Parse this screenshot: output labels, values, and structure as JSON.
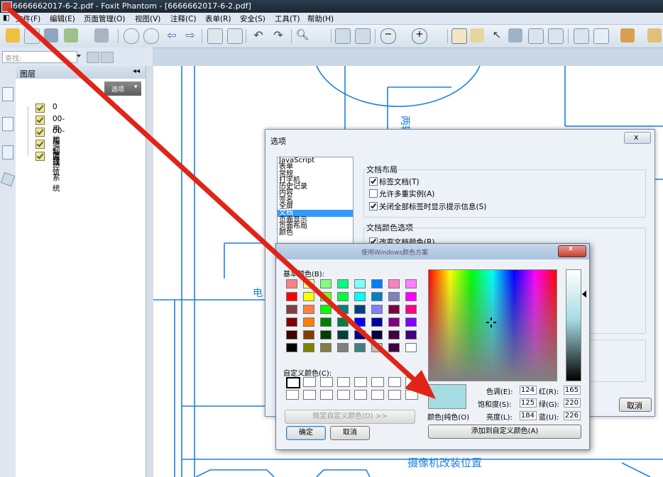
{
  "window": {
    "title": "6666662017-6-2.pdf - Foxit Phantom - [6666662017-6-2.pdf]"
  },
  "menu": [
    "文件(F)",
    "编辑(E)",
    "页面管理(O)",
    "视图(V)",
    "注释(C)",
    "表单(R)",
    "安全(S)",
    "工具(T)",
    "帮助(H)"
  ],
  "search": {
    "placeholder": "查找:"
  },
  "layers_panel": {
    "title": "图层",
    "options_label": "选项",
    "items": [
      "0",
      "00-用地红线",
      "00-规划建筑",
      "墙面",
      "监控系统"
    ]
  },
  "drawing": {
    "text_top": "两轮",
    "text_left": "电",
    "text_bottom": "摄像机改装位置"
  },
  "options_dialog": {
    "title": "选项",
    "close": "x",
    "categories": [
      "JavaScript",
      "表单",
      "常规",
      "打字机",
      "历史记录",
      "内容",
      "签名",
      "全屏",
      "文档",
      "页面显示",
      "页面布局",
      "颜色"
    ],
    "selected_category": "文档",
    "layout_group": "文档布局",
    "layout_options": [
      {
        "label": "标签文档(T)",
        "checked": true
      },
      {
        "label": "允许多重实例(A)",
        "checked": false
      },
      {
        "label": "关闭全部标签时显示提示信息(S)",
        "checked": true
      }
    ],
    "color_group": "文档颜色选项",
    "color_options": [
      {
        "label": "改变文档颜色(R)",
        "checked": true
      }
    ],
    "cancel": "取消"
  },
  "color_dialog": {
    "title": "使用Windows颜色方案",
    "close": "x",
    "basic_label": "基本颜色(B):",
    "custom_label": "自定义颜色(C):",
    "define_custom": "规定自定义颜色(D) >>",
    "ok": "确定",
    "cancel": "取消",
    "add_custom": "添加到自定义颜色(A)",
    "solid_label": "颜色|纯色(O)",
    "fields": {
      "hue": {
        "label": "色调(E):",
        "value": "124"
      },
      "sat": {
        "label": "饱和度(S):",
        "value": "125"
      },
      "lum": {
        "label": "亮度(L):",
        "value": "184"
      },
      "red": {
        "label": "红(R):",
        "value": "165"
      },
      "green": {
        "label": "绿(G):",
        "value": "220"
      },
      "blue": {
        "label": "蓝(U):",
        "value": "226"
      }
    },
    "basic_colors": [
      [
        "#ff8080",
        "#ffff80",
        "#80ff80",
        "#00ff80",
        "#80ffff",
        "#0080ff",
        "#ff80c0",
        "#ff80ff"
      ],
      [
        "#ff0000",
        "#ffff00",
        "#80ff00",
        "#00ff40",
        "#00ffff",
        "#0080c0",
        "#8080c0",
        "#ff00ff"
      ],
      [
        "#804040",
        "#ff8040",
        "#00ff00",
        "#008080",
        "#004080",
        "#8080ff",
        "#800040",
        "#ff0080"
      ],
      [
        "#800000",
        "#ff8000",
        "#008000",
        "#008040",
        "#0000ff",
        "#0000a0",
        "#800080",
        "#8000ff"
      ],
      [
        "#400000",
        "#804000",
        "#004000",
        "#004040",
        "#000080",
        "#000040",
        "#400040",
        "#400080"
      ],
      [
        "#000000",
        "#808000",
        "#808040",
        "#808080",
        "#408080",
        "#c0c0c0",
        "#400040",
        "#ffffff"
      ]
    ],
    "current_color": "#a5dce2"
  },
  "colors": {
    "annotation_arrow": "#e02418",
    "drawing_line": "#1e7fe0"
  }
}
